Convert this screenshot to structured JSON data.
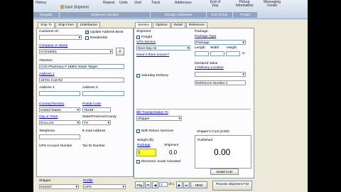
{
  "toolbar": {
    "history": "History",
    "save_shipment": "Save Shipment",
    "repeat": "Repeat",
    "undo": "Undo",
    "void": "Void",
    "track": "Track",
    "addresses": "Addresses",
    "end_of_day": "End of Day",
    "pickup_information": "Pickup Information",
    "messaging_center": "Messaging Center",
    "group_navigate": "Navigate",
    "group_shipment_activities": "Shipment Activities",
    "group_storage_addresses": "Storage Addresses",
    "group_end_of_day": "End of Day",
    "group_freight": "Freight"
  },
  "left_tabs": [
    "Ship To",
    "Ship From",
    "Distribution"
  ],
  "right_tabs": [
    "Service",
    "Options",
    "Detail",
    "Reference"
  ],
  "ship_to": {
    "customer_id_label": "Customer ID",
    "update_address_book": "Update Address Book",
    "residential": "Residential",
    "company_label": "Company or Name",
    "company_value": "CVS16801",
    "attention_label": "Attention",
    "attention_value": "CVS Pharmacy # 16801 inside Target",
    "address1_label": "Address 1",
    "address1_value": "16731 Coit Rd",
    "address2_label": "Address 2",
    "address3_label": "Address 3",
    "country_label": "Country/Territory",
    "country_value": "United States",
    "postal_label": "Postal Code",
    "postal_value": "75248-",
    "city_label": "City or Town",
    "city_value": "DALLAS",
    "state_label": "State/Province/County",
    "state_value": "TX",
    "telephone_label": "Telephone",
    "email_label": "E-mail Address",
    "ups_account_label": "UPS Account Number",
    "tax_id_label": "Tax ID Number"
  },
  "service": {
    "shipment_label": "Shipment",
    "freight_label": "Freight",
    "ups_service_label": "UPS Service",
    "ups_service_value": "Next Day Air",
    "need_it_sooner": "Need it there sooner?",
    "saturday_delivery": "Saturday Delivery",
    "package_label": "Package",
    "package_type_label": "Package Type",
    "package_type_value": "Package",
    "length_label": "Length",
    "width_label": "Width",
    "height_label": "Height",
    "dim_unit": "in",
    "declared_value_label": "Declared Value",
    "delivery_location_label": "1 Delivery Location",
    "reference_number2_label": "Reference Number 2",
    "bill_transport_label": "Bill Transportation To",
    "bill_transport_value": "Shipper",
    "with_return_services": "With Return Services",
    "weight_label": "Weight (lb)",
    "weight_package_label": "Package",
    "weight_shipment_label": "Shipment",
    "weight_package_value": "1",
    "weight_shipment_value": "0.0",
    "electronic_scale": "Electronic Scale Activated",
    "shipper_cost_label": "Shipper's Cost (USD)",
    "published_label": "Published",
    "published_value": "0.00",
    "detail_cost_button": "Detail Cost"
  },
  "bottom": {
    "shipper_label": "Shipper",
    "shipper_value": "816167",
    "profile_label": "Profile",
    "profile_value": "UPS",
    "pkg_label": "Pkg",
    "pkg_page": "1",
    "of_label": "of 1",
    "new_button": "NEW",
    "process_button": "Process Shipment F10"
  }
}
